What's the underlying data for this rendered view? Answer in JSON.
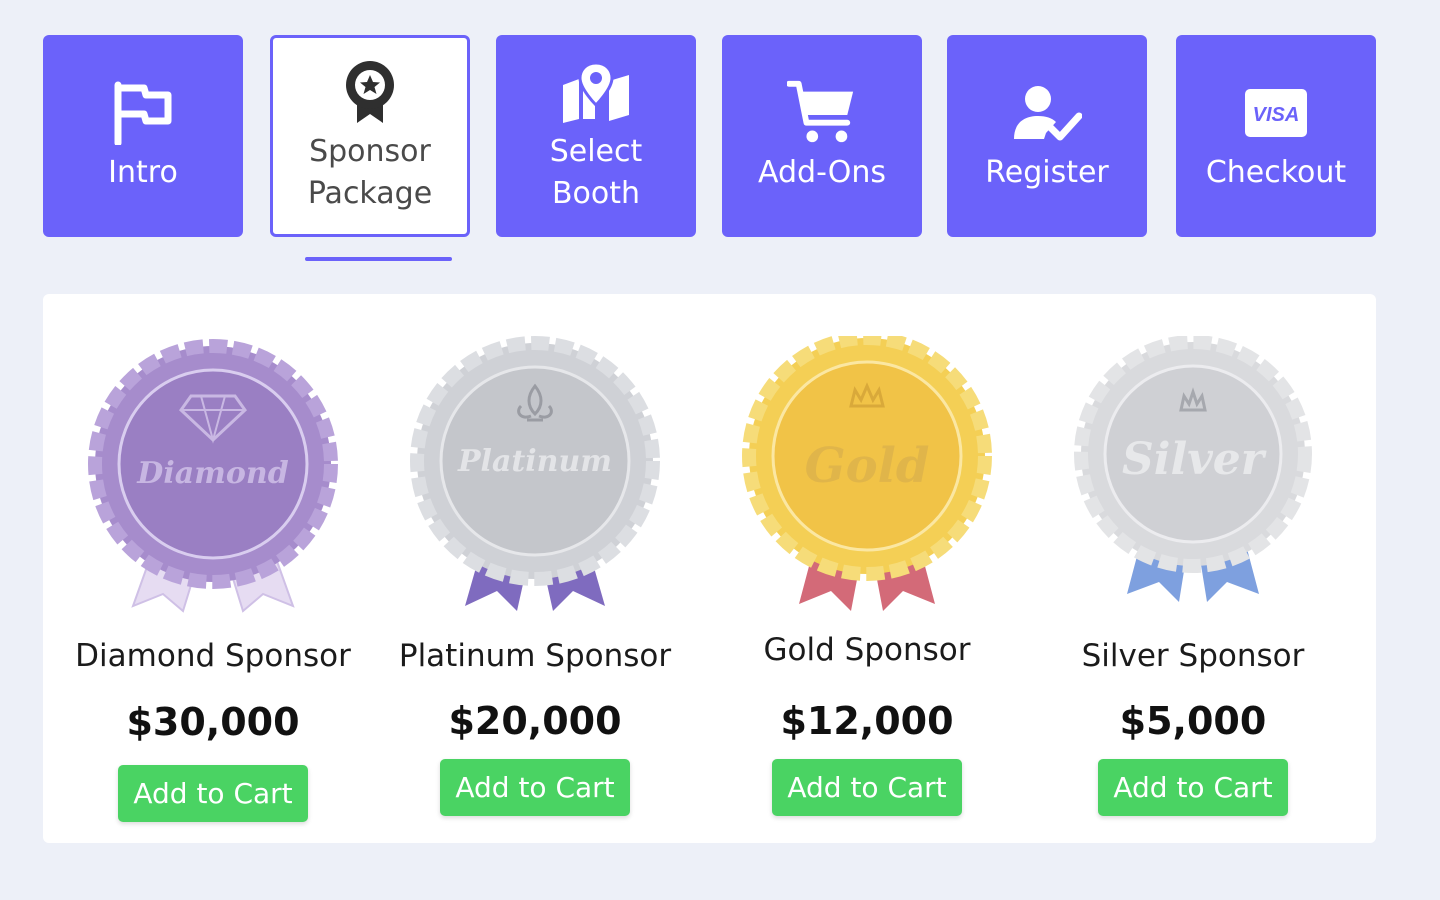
{
  "steps": [
    {
      "label_lines": [
        "Intro"
      ],
      "icon": "flag-icon",
      "active": false
    },
    {
      "label_lines": [
        "Sponsor",
        "Package"
      ],
      "icon": "award-ribbon-icon",
      "active": true
    },
    {
      "label_lines": [
        "Select",
        "Booth"
      ],
      "icon": "map-pin-icon",
      "active": false
    },
    {
      "label_lines": [
        "Add-Ons"
      ],
      "icon": "shopping-cart-icon",
      "active": false
    },
    {
      "label_lines": [
        "Register"
      ],
      "icon": "user-check-icon",
      "active": false
    },
    {
      "label_lines": [
        "Checkout"
      ],
      "icon": "visa-card-icon",
      "active": false
    }
  ],
  "visa_text": "VISA",
  "packages": [
    {
      "name": "Diamond Sponsor",
      "price": "$30,000",
      "button": "Add to Cart",
      "medal_word": "Diamond",
      "medal_symbol": "diamond-icon",
      "medal_color": "#a68ccc",
      "ribbon_color": "#e6dcf2"
    },
    {
      "name": "Platinum Sponsor",
      "price": "$20,000",
      "button": "Add to Cart",
      "medal_word": "Platinum",
      "medal_symbol": "fleur-de-lis-icon",
      "medal_color": "#cfd1d6",
      "ribbon_color": "#7f6bbf"
    },
    {
      "name": "Gold Sponsor",
      "price": "$12,000",
      "button": "Add to Cart",
      "medal_word": "Gold",
      "medal_symbol": "crown-icon",
      "medal_color": "#f4cf55",
      "ribbon_color": "#d36a78"
    },
    {
      "name": "Silver Sponsor",
      "price": "$5,000",
      "button": "Add to Cart",
      "medal_word": "Silver",
      "medal_symbol": "crown-icon",
      "medal_color": "#d9dadd",
      "ribbon_color": "#7ea0df"
    }
  ],
  "colors": {
    "accent": "#6b62fa",
    "button_green": "#4ad363",
    "background": "#edf0f8"
  }
}
